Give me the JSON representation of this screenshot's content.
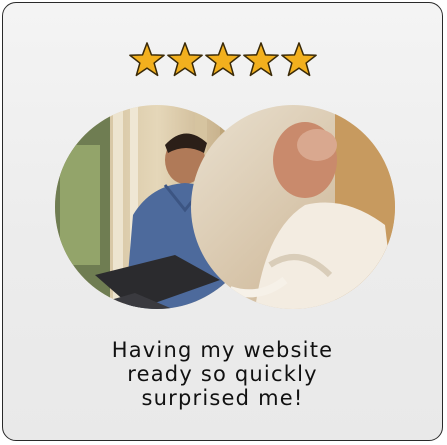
{
  "testimonial": {
    "rating": 5,
    "rating_max": 5,
    "star_color": "#f2b01e",
    "star_outline_color": "#3a2a08",
    "image_icon": "customer-photo",
    "quote_lines": [
      "Having my website",
      "ready so quickly",
      "surprised me!"
    ]
  }
}
